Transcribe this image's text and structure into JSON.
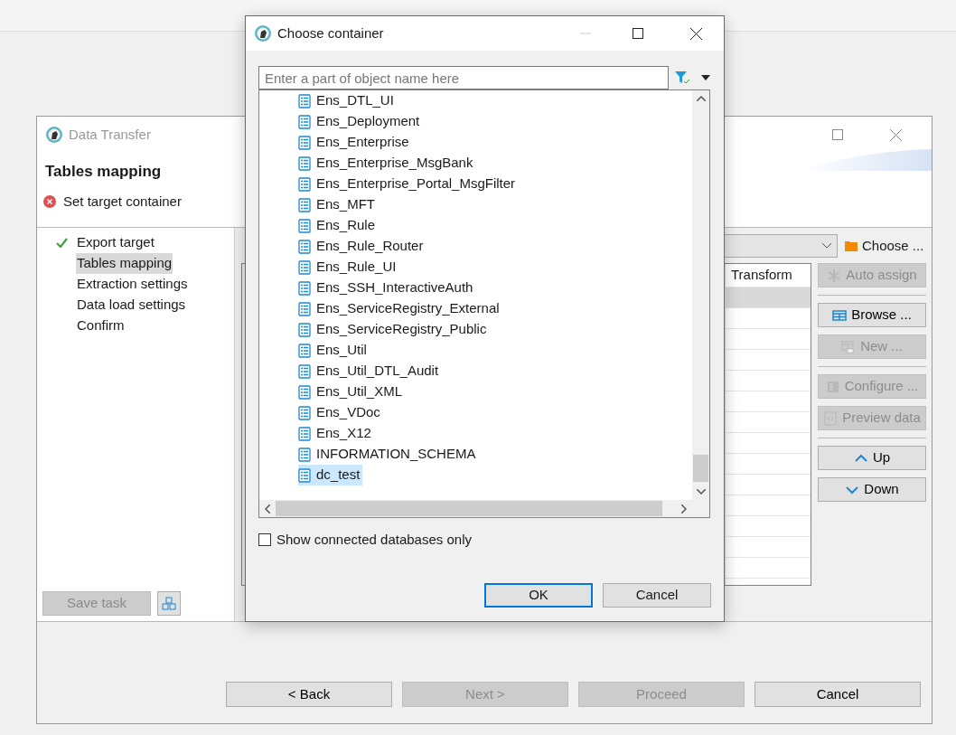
{
  "main_window": {
    "title": "Data Transfer",
    "page_title": "Tables mapping",
    "message": "Set target container",
    "steps": [
      {
        "label": "Export target",
        "done": true,
        "selected": false
      },
      {
        "label": "Tables mapping",
        "done": false,
        "selected": true
      },
      {
        "label": "Extraction settings",
        "done": false,
        "selected": false
      },
      {
        "label": "Data load settings",
        "done": false,
        "selected": false
      },
      {
        "label": "Confirm",
        "done": false,
        "selected": false
      }
    ],
    "save_task": {
      "label": "Save task",
      "disabled": true
    },
    "choose_button": "Choose ...",
    "table": {
      "columns": [
        "Transform"
      ],
      "rows": [
        {
          "selected": true
        },
        {
          "selected": false
        },
        {
          "selected": false
        },
        {
          "selected": false
        },
        {
          "selected": false
        },
        {
          "selected": false
        },
        {
          "selected": false
        },
        {
          "selected": false
        },
        {
          "selected": false
        },
        {
          "selected": false
        },
        {
          "selected": false
        },
        {
          "selected": false
        },
        {
          "selected": false
        },
        {
          "selected": false
        }
      ]
    },
    "button_groups": [
      [
        {
          "kind": "auto",
          "label": "Auto assign",
          "disabled": true
        }
      ],
      [
        {
          "kind": "browse",
          "label": "Browse ...",
          "disabled": false
        },
        {
          "kind": "new",
          "label": "New ...",
          "disabled": true
        }
      ],
      [
        {
          "kind": "configure",
          "label": "Configure ...",
          "disabled": true
        },
        {
          "kind": "preview",
          "label": "Preview data",
          "disabled": true
        }
      ],
      [
        {
          "kind": "up",
          "label": "Up",
          "disabled": false
        },
        {
          "kind": "down",
          "label": "Down",
          "disabled": false
        }
      ]
    ],
    "footer_buttons": [
      {
        "label": "< Back",
        "disabled": false
      },
      {
        "label": "Next >",
        "disabled": true
      },
      {
        "label": "Proceed",
        "disabled": true
      },
      {
        "label": "Cancel",
        "disabled": false
      }
    ]
  },
  "dialog": {
    "title": "Choose container",
    "search": {
      "placeholder": "Enter a part of object name here"
    },
    "items": [
      {
        "label": "Ens_DTL_UI",
        "selected": false
      },
      {
        "label": "Ens_Deployment",
        "selected": false
      },
      {
        "label": "Ens_Enterprise",
        "selected": false
      },
      {
        "label": "Ens_Enterprise_MsgBank",
        "selected": false
      },
      {
        "label": "Ens_Enterprise_Portal_MsgFilter",
        "selected": false
      },
      {
        "label": "Ens_MFT",
        "selected": false
      },
      {
        "label": "Ens_Rule",
        "selected": false
      },
      {
        "label": "Ens_Rule_Router",
        "selected": false
      },
      {
        "label": "Ens_Rule_UI",
        "selected": false
      },
      {
        "label": "Ens_SSH_InteractiveAuth",
        "selected": false
      },
      {
        "label": "Ens_ServiceRegistry_External",
        "selected": false
      },
      {
        "label": "Ens_ServiceRegistry_Public",
        "selected": false
      },
      {
        "label": "Ens_Util",
        "selected": false
      },
      {
        "label": "Ens_Util_DTL_Audit",
        "selected": false
      },
      {
        "label": "Ens_Util_XML",
        "selected": false
      },
      {
        "label": "Ens_VDoc",
        "selected": false
      },
      {
        "label": "Ens_X12",
        "selected": false
      },
      {
        "label": "INFORMATION_SCHEMA",
        "selected": false
      },
      {
        "label": "dc_test",
        "selected": true
      }
    ],
    "checkbox": {
      "label": "Show connected databases only",
      "checked": false
    },
    "buttons": [
      {
        "label": "OK",
        "default": true
      },
      {
        "label": "Cancel",
        "default": false
      }
    ]
  }
}
